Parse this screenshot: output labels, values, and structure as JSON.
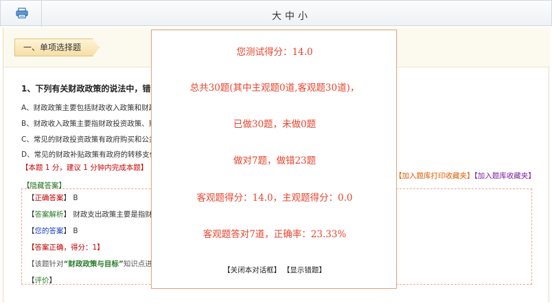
{
  "toolbar": {
    "print_icon": "printer-icon",
    "font_large": "大",
    "font_medium": "中",
    "font_small": "小"
  },
  "section": {
    "title": "一、单项选择题"
  },
  "question": {
    "title": "1、下列有关财政政策的说法中，错",
    "options": [
      "A、财政政策主要包括财政收入政策和财政",
      "B、财政收入政策主要指财政投资政策、财",
      "C、常见的财政投资政策有政府购买和公共",
      "D、常见的财政补贴政策有政府的转移支付"
    ],
    "time_hint": "【本题 1 分，建议 1 分钟内完成本题】",
    "hidden_answer_label": "【隐藏答案】",
    "correct_answer_label": "正确答案",
    "correct_answer_value": "B",
    "explanation_label": "答案解析",
    "explanation_text": "财政支出政策主要是指财",
    "your_answer_label": "您的答案",
    "your_answer_value": "B",
    "result_label": "【答案正确，得分：1】",
    "kp_prefix": "【该题针对",
    "kp_name": "“财政政策与目标”",
    "kp_suffix": "知识点进",
    "comment_label": "评价"
  },
  "favorites": {
    "print_fav": "【加入题库打印收藏夹】",
    "lib_fav": "【加入题库收藏夹】"
  },
  "dialog": {
    "score": "您测试得分：14.0",
    "total": "总共30题(其中主观题0道,客观题30道)，",
    "done": "已做30题，未做0题",
    "right_wrong": "做对7题，做错23题",
    "scores": "客观题得分：14.0，主观题得分：0.0",
    "accuracy": "客观题答对7道，正确率：23.33%",
    "close_button": "【关闭本对话框】",
    "show_wrong_button": "【显示错题】"
  },
  "colors": {
    "dialog_text": "#e8432c",
    "dialog_border": "#e3a27c",
    "answer_border": "#f0a58a",
    "label_red": "#c00000",
    "label_blue": "#1b3fbf",
    "label_green": "#2a7a2a",
    "fav_orange": "#e05a00",
    "fav_purple": "#7a1fa2"
  }
}
